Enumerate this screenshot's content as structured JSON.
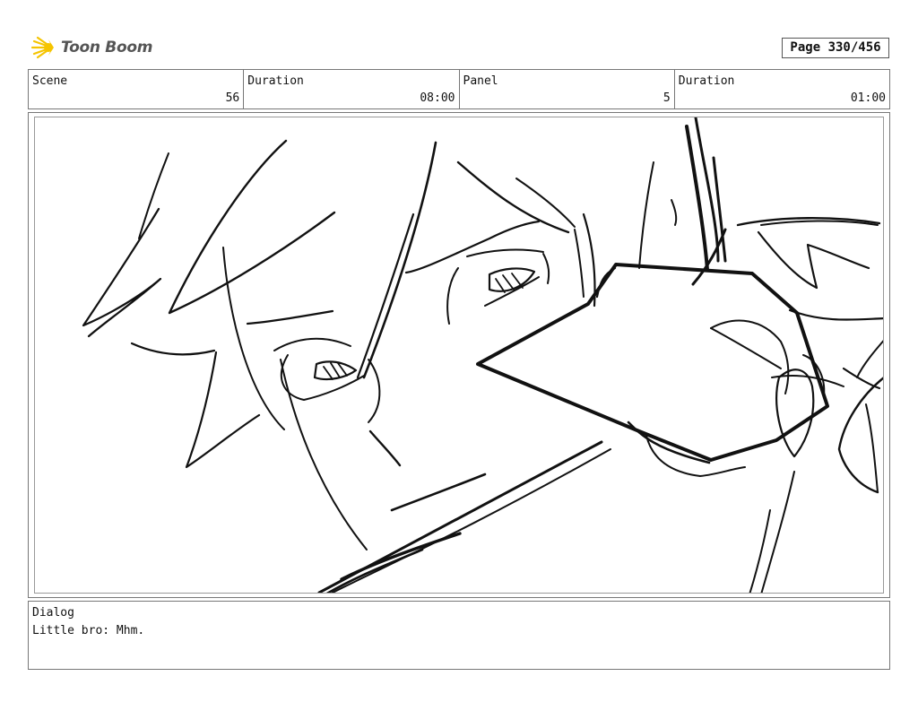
{
  "brand": {
    "name": "Toon Boom",
    "accent": "#f5c400"
  },
  "page": {
    "label": "Page 330/456"
  },
  "header": {
    "scene_label": "Scene",
    "scene_value": "56",
    "scene_duration_label": "Duration",
    "scene_duration_value": "08:00",
    "panel_label": "Panel",
    "panel_value": "5",
    "panel_duration_label": "Duration",
    "panel_duration_value": "01:00"
  },
  "dialog": {
    "label": "Dialog",
    "text": "Little bro: Mhm."
  }
}
